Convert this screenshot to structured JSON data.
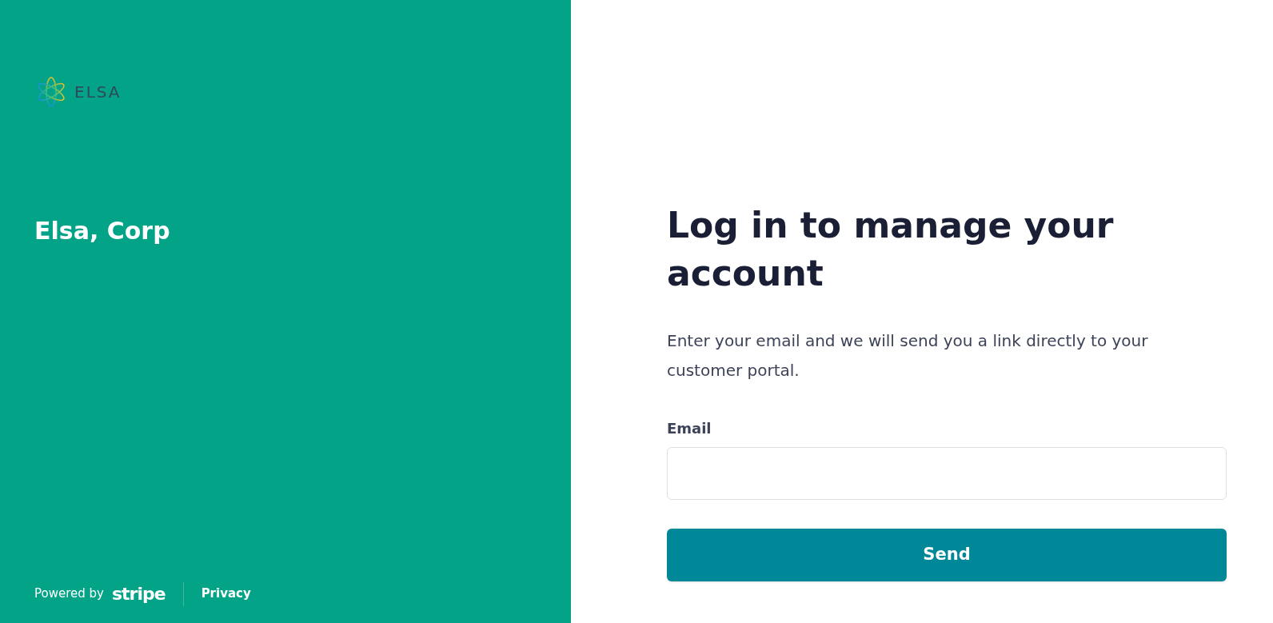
{
  "brand": {
    "logo_text": "ELSA",
    "company": "Elsa, Corp"
  },
  "footer": {
    "powered_by": "Powered by",
    "stripe": "stripe",
    "privacy": "Privacy"
  },
  "login": {
    "title": "Log in to manage your account",
    "description": "Enter your email and we will send you a link directly to your customer portal.",
    "email_label": "Email",
    "button": "Send"
  }
}
